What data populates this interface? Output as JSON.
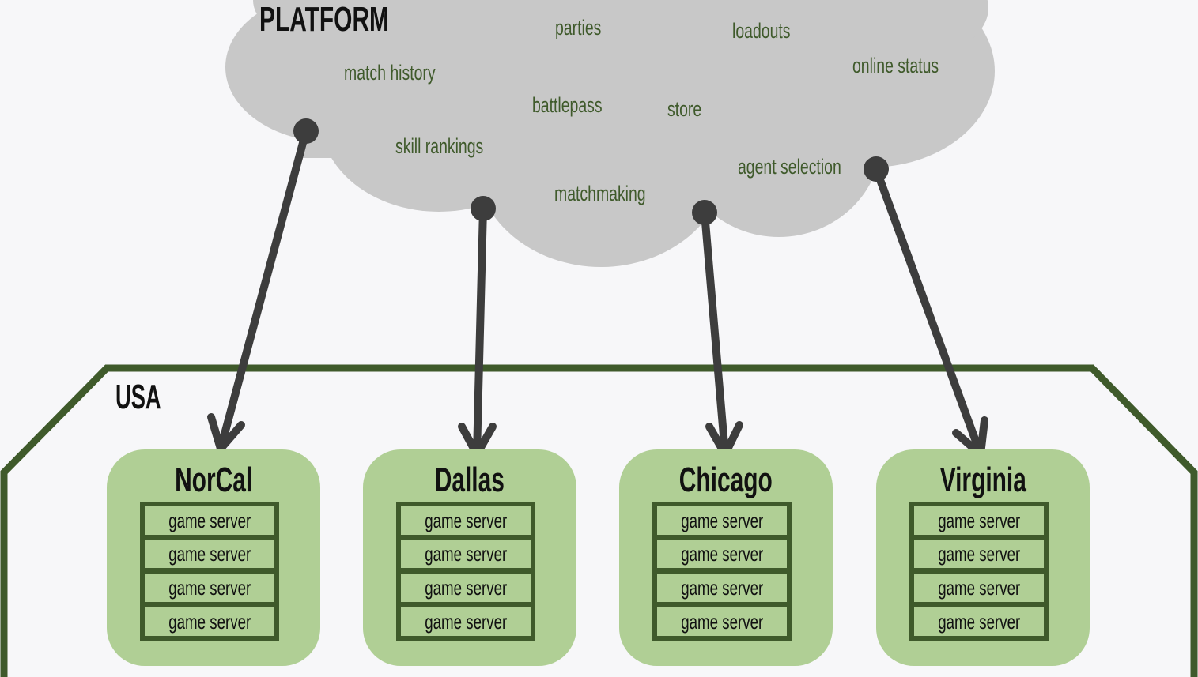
{
  "platform": {
    "title": "PLATFORM",
    "services": [
      "parties",
      "loadouts",
      "match history",
      "online status",
      "battlepass",
      "store",
      "skill rankings",
      "agent selection",
      "matchmaking"
    ]
  },
  "country": {
    "label": "USA",
    "regions": [
      {
        "name": "NorCal",
        "servers": [
          "game server",
          "game server",
          "game server",
          "game server"
        ]
      },
      {
        "name": "Dallas",
        "servers": [
          "game server",
          "game server",
          "game server",
          "game server"
        ]
      },
      {
        "name": "Chicago",
        "servers": [
          "game server",
          "game server",
          "game server",
          "game server"
        ]
      },
      {
        "name": "Virginia",
        "servers": [
          "game server",
          "game server",
          "game server",
          "game server"
        ]
      }
    ]
  },
  "colors": {
    "cloud": "#c8c8c8",
    "service_text": "#3f5a2b",
    "border": "#3f5a2b",
    "region_fill": "#b0cf95",
    "arrow": "#3d3d3d",
    "background": "#f7f7f9"
  },
  "connections": [
    {
      "from": "platform",
      "to": "NorCal"
    },
    {
      "from": "platform",
      "to": "Dallas"
    },
    {
      "from": "platform",
      "to": "Chicago"
    },
    {
      "from": "platform",
      "to": "Virginia"
    }
  ]
}
